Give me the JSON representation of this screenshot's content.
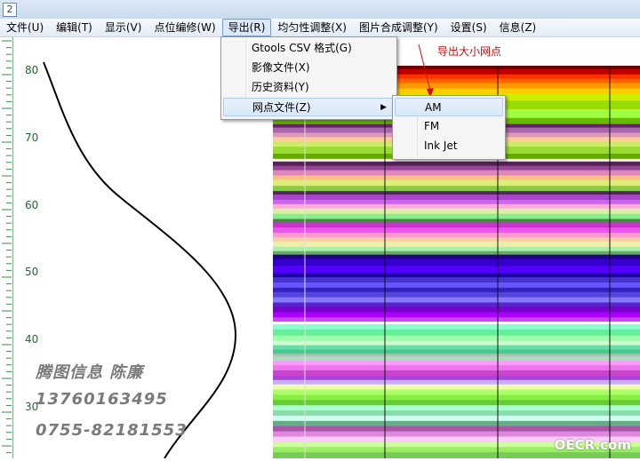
{
  "titlebar": {
    "icon_glyph": "2"
  },
  "menubar": {
    "items": [
      {
        "label": "文件(U)",
        "active": false
      },
      {
        "label": "编辑(T)",
        "active": false
      },
      {
        "label": "显示(V)",
        "active": false
      },
      {
        "label": "点位编修(W)",
        "active": false
      },
      {
        "label": "导出(R)",
        "active": true
      },
      {
        "label": "均匀性调整(X)",
        "active": false
      },
      {
        "label": "图片合成调整(Y)",
        "active": false
      },
      {
        "label": "设置(S)",
        "active": false
      },
      {
        "label": "信息(Z)",
        "active": false
      }
    ]
  },
  "export_menu": {
    "items": [
      {
        "label": "Gtools CSV 格式(G)",
        "has_submenu": false
      },
      {
        "label": "影像文件(X)",
        "has_submenu": false
      },
      {
        "label": "历史资料(Y)",
        "has_submenu": false
      },
      {
        "label": "网点文件(Z)",
        "has_submenu": true
      }
    ]
  },
  "dot_file_submenu": {
    "items": [
      {
        "label": "AM"
      },
      {
        "label": "FM"
      },
      {
        "label": "Ink Jet"
      }
    ]
  },
  "annotation": {
    "text": "导出大小网点",
    "color": "#c01010"
  },
  "axis": {
    "y_labels": [
      "80",
      "70",
      "60",
      "50",
      "40",
      "30"
    ]
  },
  "watermark": {
    "line1": "腾图信息    陈廉",
    "line2": "13760163495",
    "line3": "0755-82181553"
  },
  "site_watermark": "OECR.com",
  "colors": {
    "menu_highlight": "#dbe8f7",
    "axis_label": "#1d6b2b",
    "curve": "#000000"
  }
}
